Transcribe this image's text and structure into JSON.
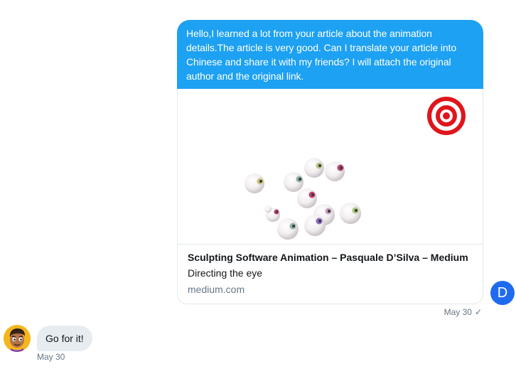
{
  "conversation": {
    "sent": {
      "text": "Hello,I learned a lot from your article about the animation details.The article is very good. Can I translate your article into Chinese and share it with my friends? I will attach the original author and the original link.",
      "timestamp": "May 30",
      "status_icon": "checkmark-icon",
      "status_glyph": "✓"
    },
    "card": {
      "title": "Sculpting Software Animation – Pasquale D’Silva – Medium",
      "description": "Directing the eye",
      "domain": "medium.com",
      "image": "eyeballs-and-target-illustration"
    },
    "own_avatar": {
      "initial": "D",
      "color": "#1f6bf0"
    },
    "received": {
      "text": "Go for it!",
      "timestamp": "May 30",
      "avatar": "cartoon-character-avatar"
    }
  },
  "colors": {
    "accent": "#1da1f2",
    "received_bubble": "#e6ecf0",
    "muted_text": "#657786",
    "target_red": "#e0151c"
  }
}
